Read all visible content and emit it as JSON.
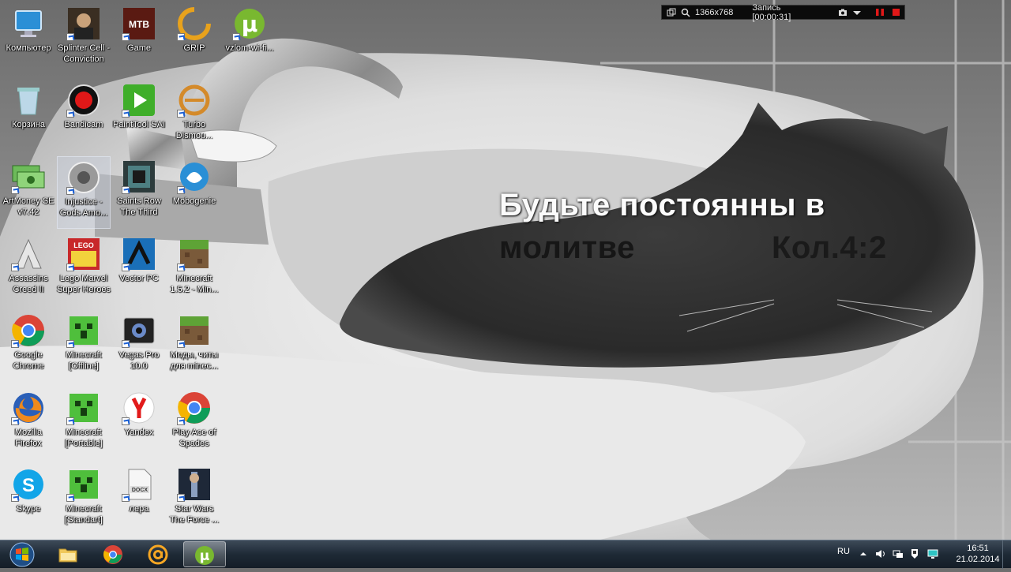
{
  "recorder": {
    "resolution": "1366x768",
    "status": "Запись [00:00:31]"
  },
  "wallpaper": {
    "verse_line1": "Будьте постоянны в",
    "verse_line2": "молитве",
    "verse_ref": "Кол.4:2"
  },
  "desktop_icons": [
    {
      "label": "Компьютер",
      "icon": "computer-icon"
    },
    {
      "label": "Splinter Cell - Conviction",
      "icon": "splinter-cell-icon"
    },
    {
      "label": "Game",
      "icon": "mtb-game-icon"
    },
    {
      "label": "GRIP",
      "icon": "grip-icon"
    },
    {
      "label": "vzlom-wi-fi...",
      "icon": "utorrent-icon"
    },
    {
      "label": "Корзина",
      "icon": "recycle-bin-icon"
    },
    {
      "label": "Bandicam",
      "icon": "bandicam-icon"
    },
    {
      "label": "PaintTool SAI",
      "icon": "painttool-icon"
    },
    {
      "label": "Turbo Dismou...",
      "icon": "turbo-dismount-icon"
    },
    {
      "label": "ArtMoney SE v7.42",
      "icon": "artmoney-icon"
    },
    {
      "label": "Injustice - Gods Amo...",
      "icon": "injustice-icon"
    },
    {
      "label": "Saints Row The Third",
      "icon": "saints-row-icon"
    },
    {
      "label": "Mobogenie",
      "icon": "mobogenie-icon"
    },
    {
      "label": "Assassins Creed II",
      "icon": "assassins-creed-icon"
    },
    {
      "label": "Lego Marvel Super Heroes",
      "icon": "lego-marvel-icon"
    },
    {
      "label": "Vector PC",
      "icon": "vector-icon"
    },
    {
      "label": "Minecraft 1.5.2 - Min...",
      "icon": "minecraft-block-icon"
    },
    {
      "label": "Google Chrome",
      "icon": "chrome-icon"
    },
    {
      "label": "Minecraft [Offline]",
      "icon": "minecraft-creeper-icon"
    },
    {
      "label": "Vegas Pro 10.0",
      "icon": "vegas-pro-icon"
    },
    {
      "label": "Моды, читы для minec...",
      "icon": "minecraft-block-icon"
    },
    {
      "label": "Mozilla Firefox",
      "icon": "firefox-icon"
    },
    {
      "label": "Minecraft [Portable]",
      "icon": "minecraft-creeper-icon"
    },
    {
      "label": "Yandex",
      "icon": "yandex-icon"
    },
    {
      "label": "Play Ace of Spades",
      "icon": "chrome-icon"
    },
    {
      "label": "Skype",
      "icon": "skype-icon"
    },
    {
      "label": "Minecraft [Standart]",
      "icon": "minecraft-creeper-icon"
    },
    {
      "label": "лера",
      "icon": "docx-file-icon"
    },
    {
      "label": "Star Wars The Force ...",
      "icon": "star-wars-icon"
    }
  ],
  "taskbar": {
    "pinned": [
      {
        "name": "explorer",
        "icon": "folder-icon"
      },
      {
        "name": "chrome",
        "icon": "chrome-icon"
      },
      {
        "name": "mail-agent",
        "icon": "mail-at-icon"
      },
      {
        "name": "utorrent",
        "icon": "utorrent-icon",
        "active": true
      }
    ],
    "lang": "RU",
    "time": "16:51",
    "date": "21.02.2014"
  }
}
